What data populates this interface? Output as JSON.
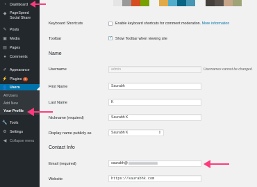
{
  "sidebar": {
    "items": [
      {
        "label": "Dashboard",
        "icon": "dashboard-icon"
      },
      {
        "label": "PageSpeed Social Share",
        "icon": "share-icon"
      },
      {
        "label": "Posts",
        "icon": "posts-icon"
      },
      {
        "label": "Media",
        "icon": "media-icon"
      },
      {
        "label": "Pages",
        "icon": "pages-icon"
      },
      {
        "label": "Comments",
        "icon": "comments-icon"
      },
      {
        "label": "Appearance",
        "icon": "appearance-icon"
      },
      {
        "label": "Plugins",
        "icon": "plugins-icon",
        "badge": "6"
      },
      {
        "label": "Users",
        "icon": "users-icon"
      },
      {
        "label": "Tools",
        "icon": "tools-icon"
      },
      {
        "label": "Settings",
        "icon": "settings-icon"
      },
      {
        "label": "Collapse menu",
        "icon": "collapse-icon"
      }
    ],
    "submenu": [
      "All Users",
      "Add New",
      "Your Profile"
    ]
  },
  "colors": {
    "sidebar_bg": "#23282d",
    "active": "#0073aa",
    "arrow": "#ff3a7c",
    "swatches": [
      "#e5e5e5",
      "#999999",
      "#d54e21",
      "#78a000",
      "#e1a948",
      "#52accc",
      "#096484",
      "#4796b3",
      "#46403c",
      "#59524c",
      "#c7a589",
      "#9ea476"
    ]
  },
  "form": {
    "keyboard_shortcuts": {
      "label": "Keyboard Shortcuts",
      "checkbox_text": "Enable keyboard shortcuts for comment moderation.",
      "link_text": "More information",
      "checked": false
    },
    "toolbar": {
      "label": "Toolbar",
      "checkbox_text": "Show Toolbar when viewing site",
      "checked": true
    },
    "name_section": "Name",
    "username": {
      "label": "Username",
      "value": "admin",
      "desc": "Usernames cannot be changed."
    },
    "first_name": {
      "label": "First Name",
      "value": "Saurabh"
    },
    "last_name": {
      "label": "Last Name",
      "value": "K"
    },
    "nickname": {
      "label": "Nickname (required)",
      "value": "Saurabh K"
    },
    "display_name": {
      "label": "Display name publicly as",
      "value": "Saurabh K"
    },
    "contact_section": "Contact Info",
    "email": {
      "label": "Email (required)",
      "value": "saurabh@"
    },
    "website": {
      "label": "Website",
      "value": "https://saurabhk.com"
    }
  }
}
